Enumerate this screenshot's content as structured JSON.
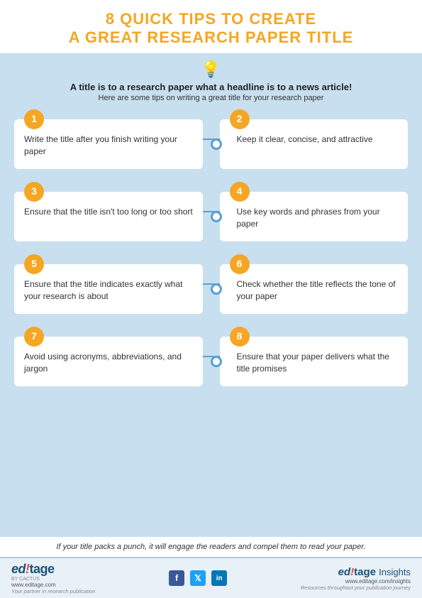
{
  "header": {
    "title_line1": "8 QUICK TIPS TO CREATE",
    "title_line2": "A GREAT RESEARCH PAPER TITLE"
  },
  "subtitle": {
    "bold": "A title is to a research paper what a headline is to a news article!",
    "light": "Here are some tips on writing a great title for your research paper"
  },
  "tips": [
    {
      "number": "1",
      "text": "Write the title after you finish writing your paper"
    },
    {
      "number": "2",
      "text": "Keep it clear, concise, and attractive"
    },
    {
      "number": "3",
      "text": "Ensure that the title isn't too long or too short"
    },
    {
      "number": "4",
      "text": "Use key words and phrases from your paper"
    },
    {
      "number": "5",
      "text": "Ensure that the title indicates exactly what your research is about"
    },
    {
      "number": "6",
      "text": "Check whether the title reflects the tone of your paper"
    },
    {
      "number": "7",
      "text": "Avoid using acronyms, abbreviations, and jargon"
    },
    {
      "number": "8",
      "text": "Ensure that your paper delivers what the title promises"
    }
  ],
  "footer_quote": "If your title packs a punch, it will engage the readers and compel them to read your paper.",
  "bottom": {
    "brand_name": "ed!tage",
    "by": "BY CACTUS",
    "url": "www.editage.com",
    "tagline": "Your partner in research publication",
    "social": [
      "f",
      "t",
      "in"
    ],
    "insights_label": "ed!tage Insights",
    "insights_url": "www.editage.com/insights",
    "insights_tagline": "Resources throughout your publication journey"
  }
}
